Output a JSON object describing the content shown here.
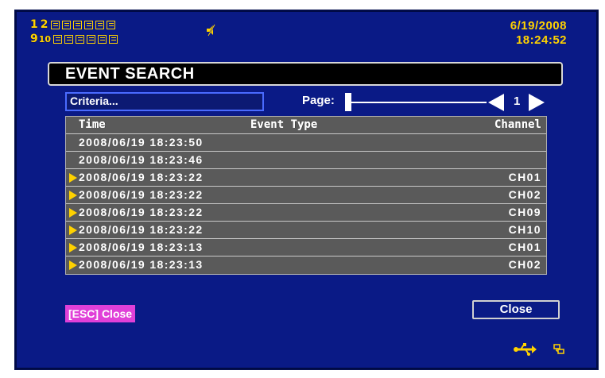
{
  "status_bar": {
    "camera_rows": [
      {
        "numbers": [
          "1",
          "2"
        ],
        "box_count": 6
      },
      {
        "numbers": [
          "9",
          "10"
        ],
        "box_count": 6
      }
    ],
    "date": "6/19/2008",
    "time": "18:24:52",
    "speaker_icon": "speaker-muted-icon",
    "accent_color": "#ffd200"
  },
  "title": "EVENT SEARCH",
  "criteria_button": "Criteria...",
  "pager": {
    "label": "Page:",
    "current_page": "1"
  },
  "table": {
    "columns": [
      "Time",
      "Event Type",
      "Channel"
    ],
    "rows": [
      {
        "time": "2008/06/19 18:23:50",
        "channel": "",
        "marked": false
      },
      {
        "time": "2008/06/19 18:23:46",
        "channel": "",
        "marked": false
      },
      {
        "time": "2008/06/19 18:23:22",
        "channel": "CH01",
        "marked": true
      },
      {
        "time": "2008/06/19 18:23:22",
        "channel": "CH02",
        "marked": true
      },
      {
        "time": "2008/06/19 18:23:22",
        "channel": "CH09",
        "marked": true
      },
      {
        "time": "2008/06/19 18:23:22",
        "channel": "CH10",
        "marked": true
      },
      {
        "time": "2008/06/19 18:23:13",
        "channel": "CH01",
        "marked": true
      },
      {
        "time": "2008/06/19 18:23:13",
        "channel": "CH02",
        "marked": true
      }
    ]
  },
  "esc_close": "[ESC] Close",
  "close_button": "Close",
  "tray_icons": [
    "usb-icon",
    "network-icon"
  ],
  "colors": {
    "background": "#0a1a86",
    "row_background": "#5a5a5a",
    "esc_highlight": "#e040d8"
  }
}
